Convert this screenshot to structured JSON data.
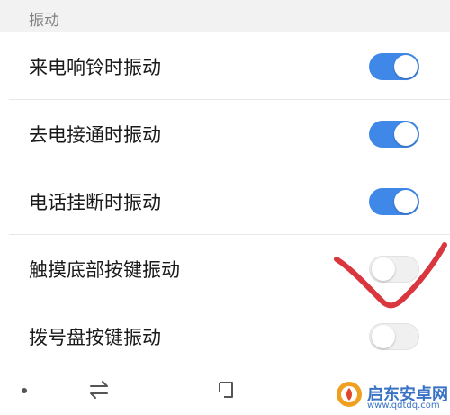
{
  "section": {
    "title": "振动"
  },
  "settings": [
    {
      "label": "来电响铃时振动",
      "enabled": true
    },
    {
      "label": "去电接通时振动",
      "enabled": true
    },
    {
      "label": "电话挂断时振动",
      "enabled": true
    },
    {
      "label": "触摸底部按键振动",
      "enabled": false
    },
    {
      "label": "拨号盘按键振动",
      "enabled": false
    }
  ],
  "colors": {
    "toggle_on": "#3f88e8",
    "toggle_off": "#f0f0f0",
    "annotation": "#d9363e"
  },
  "navbar": {
    "icons": [
      "dot-icon",
      "swap-arrows-icon",
      "recent-apps-icon"
    ]
  },
  "watermark": {
    "name": "启东安卓网",
    "url": "www.qdtdq.com"
  }
}
